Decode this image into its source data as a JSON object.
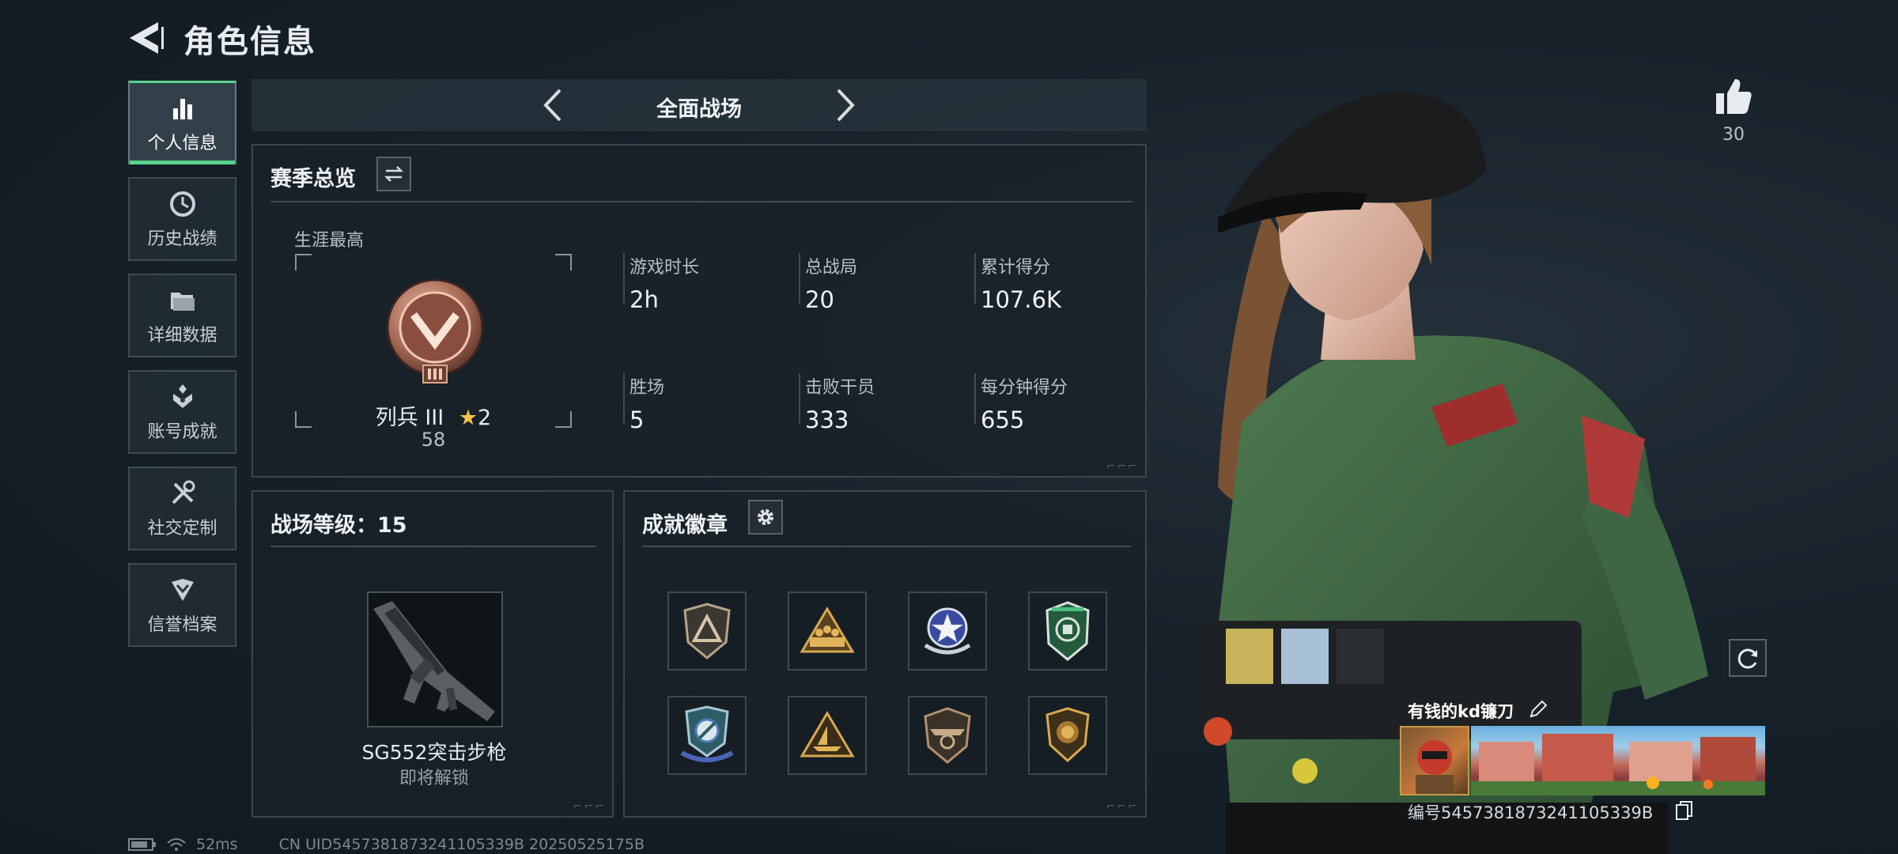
{
  "header": {
    "title": "角色信息"
  },
  "nav": {
    "items": [
      {
        "label": "个人信息",
        "icon": "bar-chart-icon",
        "active": true
      },
      {
        "label": "历史战绩",
        "icon": "clock-icon",
        "active": false
      },
      {
        "label": "详细数据",
        "icon": "folder-icon",
        "active": false
      },
      {
        "label": "账号成就",
        "icon": "achievement-icon",
        "active": false
      },
      {
        "label": "社交定制",
        "icon": "tools-icon",
        "active": false
      },
      {
        "label": "信誉档案",
        "icon": "shield-check-icon",
        "active": false
      }
    ]
  },
  "mode": {
    "title": "全面战场"
  },
  "season": {
    "title": "赛季总览",
    "career_best_label": "生涯最高",
    "rank_name": "列兵 III",
    "rank_stars": "2",
    "rank_points": "58",
    "stats": [
      {
        "label": "游戏时长",
        "value": "2h"
      },
      {
        "label": "总战局",
        "value": "20"
      },
      {
        "label": "累计得分",
        "value": "107.6K"
      },
      {
        "label": "胜场",
        "value": "5"
      },
      {
        "label": "击败干员",
        "value": "333"
      },
      {
        "label": "每分钟得分",
        "value": "655"
      }
    ]
  },
  "level": {
    "title": "战场等级：15",
    "weapon_name": "SG552突击步枪",
    "weapon_status": "即将解锁"
  },
  "badges": {
    "title": "成就徽章",
    "items": [
      {
        "icon": "badge-triangle-shield-icon",
        "color": "#b7a488"
      },
      {
        "icon": "badge-soldiers-triangle-icon",
        "color": "#c49a4a"
      },
      {
        "icon": "badge-star-wings-icon",
        "color": "#6f7fc8"
      },
      {
        "icon": "badge-green-crest-icon",
        "color": "#3f9a6a"
      },
      {
        "icon": "badge-blue-wings-icon",
        "color": "#5f8fc8"
      },
      {
        "icon": "badge-ship-triangle-icon",
        "color": "#c49a4a"
      },
      {
        "icon": "badge-eagle-shield-icon",
        "color": "#b09070"
      },
      {
        "icon": "badge-lion-shield-icon",
        "color": "#c49a4a"
      }
    ]
  },
  "player": {
    "like_count": "30",
    "name": "有钱的kd镰刀",
    "uid_label": "编号5457381873241105339B"
  },
  "status": {
    "ping": "52ms",
    "uid": "CN UID5457381873241105339B 20250525175B"
  },
  "colors": {
    "accent": "#59d38b",
    "panel_border": "#5e6b74"
  }
}
